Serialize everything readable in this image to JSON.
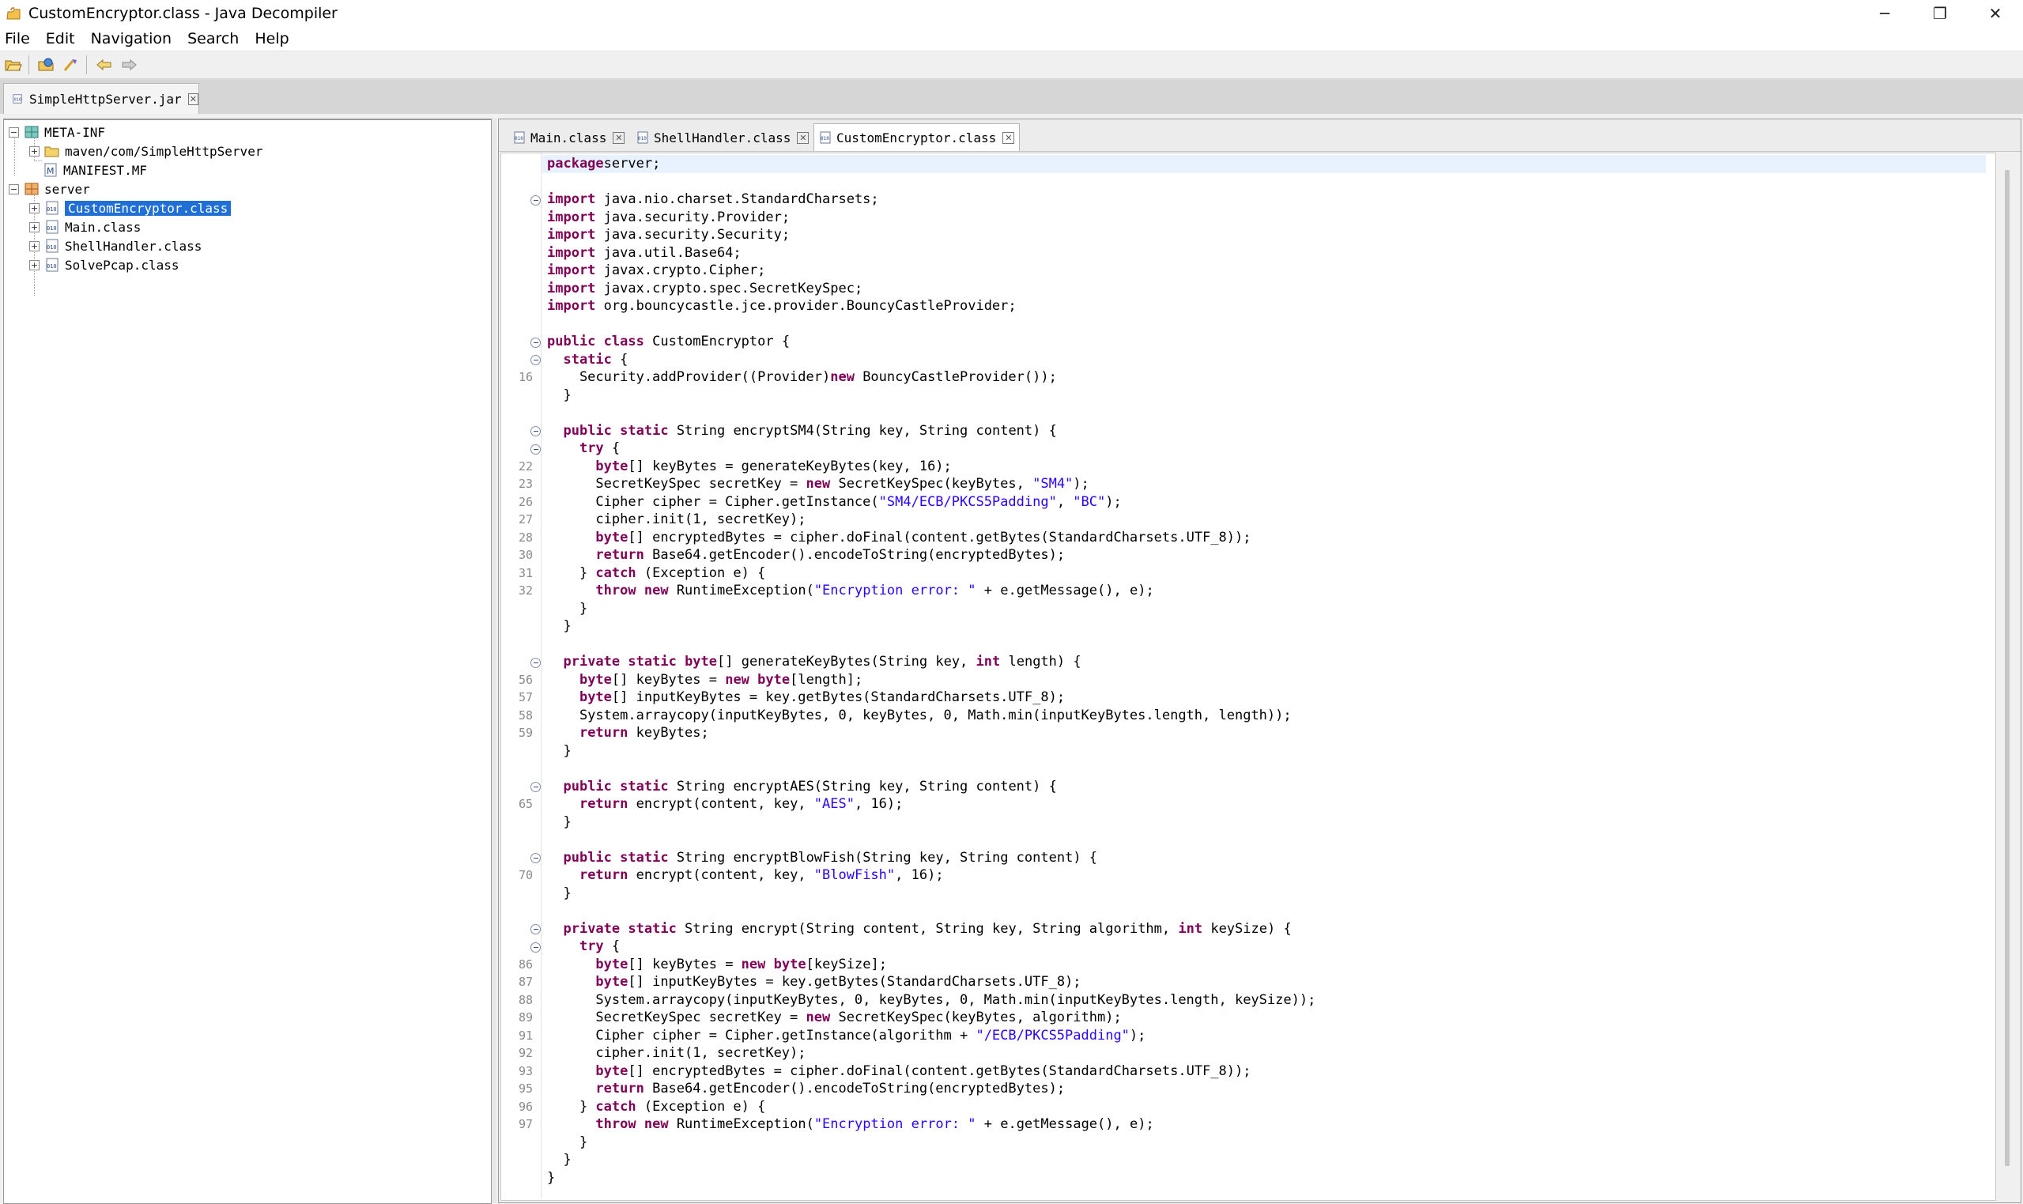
{
  "window": {
    "title": "CustomEncryptor.class - Java Decompiler",
    "controls": {
      "minimize": "─",
      "maximize": "❐",
      "close": "✕"
    }
  },
  "menu": [
    "File",
    "Edit",
    "Navigation",
    "Search",
    "Help"
  ],
  "toolbar": {
    "buttons": [
      "open-file-icon",
      "open-type-icon",
      "search-icon",
      "back-icon",
      "forward-icon"
    ]
  },
  "file_tabs": [
    {
      "label": "SimpleHttpServer.jar",
      "active": true
    }
  ],
  "tree": {
    "nodes": [
      {
        "label": "META-INF",
        "level": 0,
        "icon": "package-folder-icon",
        "expander": "−"
      },
      {
        "label": "maven/com/SimpleHttpServer",
        "level": 1,
        "icon": "folder-icon",
        "expander": "+"
      },
      {
        "label": "MANIFEST.MF",
        "level": 1,
        "icon": "manifest-icon",
        "expander": ""
      },
      {
        "label": "server",
        "level": 0,
        "icon": "package-icon",
        "expander": "−"
      },
      {
        "label": "CustomEncryptor.class",
        "level": 1,
        "icon": "class-file-icon",
        "expander": "+",
        "selected": true
      },
      {
        "label": "Main.class",
        "level": 1,
        "icon": "class-file-icon",
        "expander": "+"
      },
      {
        "label": "ShellHandler.class",
        "level": 1,
        "icon": "class-file-icon",
        "expander": "+"
      },
      {
        "label": "SolvePcap.class",
        "level": 1,
        "icon": "class-file-icon",
        "expander": "+"
      }
    ]
  },
  "editor_tabs": [
    {
      "label": "Main.class",
      "active": false
    },
    {
      "label": "ShellHandler.class",
      "active": false
    },
    {
      "label": "CustomEncryptor.class",
      "active": true
    }
  ],
  "code": {
    "lines": [
      {
        "ln": "",
        "fold": false,
        "parts": [
          [
            "kw",
            "package"
          ],
          [
            "",
            "server;"
          ]
        ]
      },
      {
        "ln": "",
        "fold": false,
        "parts": []
      },
      {
        "ln": "",
        "fold": true,
        "parts": [
          [
            "kw",
            "import"
          ],
          [
            "",
            " java.nio.charset.StandardCharsets;"
          ]
        ]
      },
      {
        "ln": "",
        "fold": false,
        "parts": [
          [
            "kw",
            "import"
          ],
          [
            "",
            " java.security.Provider;"
          ]
        ]
      },
      {
        "ln": "",
        "fold": false,
        "parts": [
          [
            "kw",
            "import"
          ],
          [
            "",
            " java.security.Security;"
          ]
        ]
      },
      {
        "ln": "",
        "fold": false,
        "parts": [
          [
            "kw",
            "import"
          ],
          [
            "",
            " java.util.Base64;"
          ]
        ]
      },
      {
        "ln": "",
        "fold": false,
        "parts": [
          [
            "kw",
            "import"
          ],
          [
            "",
            " javax.crypto.Cipher;"
          ]
        ]
      },
      {
        "ln": "",
        "fold": false,
        "parts": [
          [
            "kw",
            "import"
          ],
          [
            "",
            " javax.crypto.spec.SecretKeySpec;"
          ]
        ]
      },
      {
        "ln": "",
        "fold": false,
        "parts": [
          [
            "kw",
            "import"
          ],
          [
            "",
            " org.bouncycastle.jce.provider.BouncyCastleProvider;"
          ]
        ]
      },
      {
        "ln": "",
        "fold": false,
        "parts": []
      },
      {
        "ln": "",
        "fold": true,
        "parts": [
          [
            "kw",
            "public"
          ],
          [
            "",
            " "
          ],
          [
            "kw",
            "class"
          ],
          [
            "",
            " CustomEncryptor {"
          ]
        ]
      },
      {
        "ln": "",
        "fold": true,
        "parts": [
          [
            "",
            "  "
          ],
          [
            "kw",
            "static"
          ],
          [
            "",
            " {"
          ]
        ]
      },
      {
        "ln": "16",
        "fold": false,
        "parts": [
          [
            "",
            "    Security.addProvider((Provider)"
          ],
          [
            "kw",
            "new"
          ],
          [
            "",
            " BouncyCastleProvider());"
          ]
        ]
      },
      {
        "ln": "",
        "fold": false,
        "parts": [
          [
            "",
            "  }"
          ]
        ]
      },
      {
        "ln": "",
        "fold": false,
        "parts": []
      },
      {
        "ln": "",
        "fold": true,
        "parts": [
          [
            "",
            "  "
          ],
          [
            "kw",
            "public"
          ],
          [
            "",
            " "
          ],
          [
            "kw",
            "static"
          ],
          [
            "",
            " String encryptSM4(String key, String content) {"
          ]
        ]
      },
      {
        "ln": "",
        "fold": true,
        "parts": [
          [
            "",
            "    "
          ],
          [
            "kw",
            "try"
          ],
          [
            "",
            " {"
          ]
        ]
      },
      {
        "ln": "22",
        "fold": false,
        "parts": [
          [
            "",
            "      "
          ],
          [
            "kw",
            "byte"
          ],
          [
            "",
            "[] keyBytes = generateKeyBytes(key, 16);"
          ]
        ]
      },
      {
        "ln": "23",
        "fold": false,
        "parts": [
          [
            "",
            "      SecretKeySpec secretKey = "
          ],
          [
            "kw",
            "new"
          ],
          [
            "",
            " SecretKeySpec(keyBytes, "
          ],
          [
            "str",
            "\"SM4\""
          ],
          [
            "",
            ");"
          ]
        ]
      },
      {
        "ln": "26",
        "fold": false,
        "parts": [
          [
            "",
            "      Cipher cipher = Cipher.getInstance("
          ],
          [
            "str",
            "\"SM4/ECB/PKCS5Padding\""
          ],
          [
            "",
            ", "
          ],
          [
            "str",
            "\"BC\""
          ],
          [
            "",
            ");"
          ]
        ]
      },
      {
        "ln": "27",
        "fold": false,
        "parts": [
          [
            "",
            "      cipher.init(1, secretKey);"
          ]
        ]
      },
      {
        "ln": "28",
        "fold": false,
        "parts": [
          [
            "",
            "      "
          ],
          [
            "kw",
            "byte"
          ],
          [
            "",
            "[] encryptedBytes = cipher.doFinal(content.getBytes(StandardCharsets.UTF_8));"
          ]
        ]
      },
      {
        "ln": "30",
        "fold": false,
        "parts": [
          [
            "",
            "      "
          ],
          [
            "kw",
            "return"
          ],
          [
            "",
            " Base64.getEncoder().encodeToString(encryptedBytes);"
          ]
        ]
      },
      {
        "ln": "31",
        "fold": false,
        "parts": [
          [
            "",
            "    } "
          ],
          [
            "kw",
            "catch"
          ],
          [
            "",
            " (Exception e) {"
          ]
        ]
      },
      {
        "ln": "32",
        "fold": false,
        "parts": [
          [
            "",
            "      "
          ],
          [
            "kw",
            "throw"
          ],
          [
            "",
            " "
          ],
          [
            "kw",
            "new"
          ],
          [
            "",
            " RuntimeException("
          ],
          [
            "str",
            "\"Encryption error: \""
          ],
          [
            "",
            " + e.getMessage(), e);"
          ]
        ]
      },
      {
        "ln": "",
        "fold": false,
        "parts": [
          [
            "",
            "    }"
          ]
        ]
      },
      {
        "ln": "",
        "fold": false,
        "parts": [
          [
            "",
            "  }"
          ]
        ]
      },
      {
        "ln": "",
        "fold": false,
        "parts": []
      },
      {
        "ln": "",
        "fold": true,
        "parts": [
          [
            "",
            "  "
          ],
          [
            "kw",
            "private"
          ],
          [
            "",
            " "
          ],
          [
            "kw",
            "static"
          ],
          [
            "",
            " "
          ],
          [
            "kw",
            "byte"
          ],
          [
            "",
            "[] generateKeyBytes(String key, "
          ],
          [
            "kw",
            "int"
          ],
          [
            "",
            " length) {"
          ]
        ]
      },
      {
        "ln": "56",
        "fold": false,
        "parts": [
          [
            "",
            "    "
          ],
          [
            "kw",
            "byte"
          ],
          [
            "",
            "[] keyBytes = "
          ],
          [
            "kw",
            "new"
          ],
          [
            "",
            " "
          ],
          [
            "kw",
            "byte"
          ],
          [
            "",
            "[length];"
          ]
        ]
      },
      {
        "ln": "57",
        "fold": false,
        "parts": [
          [
            "",
            "    "
          ],
          [
            "kw",
            "byte"
          ],
          [
            "",
            "[] inputKeyBytes = key.getBytes(StandardCharsets.UTF_8);"
          ]
        ]
      },
      {
        "ln": "58",
        "fold": false,
        "parts": [
          [
            "",
            "    System.arraycopy(inputKeyBytes, 0, keyBytes, 0, Math.min(inputKeyBytes.length, length));"
          ]
        ]
      },
      {
        "ln": "59",
        "fold": false,
        "parts": [
          [
            "",
            "    "
          ],
          [
            "kw",
            "return"
          ],
          [
            "",
            " keyBytes;"
          ]
        ]
      },
      {
        "ln": "",
        "fold": false,
        "parts": [
          [
            "",
            "  }"
          ]
        ]
      },
      {
        "ln": "",
        "fold": false,
        "parts": []
      },
      {
        "ln": "",
        "fold": true,
        "parts": [
          [
            "",
            "  "
          ],
          [
            "kw",
            "public"
          ],
          [
            "",
            " "
          ],
          [
            "kw",
            "static"
          ],
          [
            "",
            " String encryptAES(String key, String content) {"
          ]
        ]
      },
      {
        "ln": "65",
        "fold": false,
        "parts": [
          [
            "",
            "    "
          ],
          [
            "kw",
            "return"
          ],
          [
            "",
            " encrypt(content, key, "
          ],
          [
            "str",
            "\"AES\""
          ],
          [
            "",
            ", 16);"
          ]
        ]
      },
      {
        "ln": "",
        "fold": false,
        "parts": [
          [
            "",
            "  }"
          ]
        ]
      },
      {
        "ln": "",
        "fold": false,
        "parts": []
      },
      {
        "ln": "",
        "fold": true,
        "parts": [
          [
            "",
            "  "
          ],
          [
            "kw",
            "public"
          ],
          [
            "",
            " "
          ],
          [
            "kw",
            "static"
          ],
          [
            "",
            " String encryptBlowFish(String key, String content) {"
          ]
        ]
      },
      {
        "ln": "70",
        "fold": false,
        "parts": [
          [
            "",
            "    "
          ],
          [
            "kw",
            "return"
          ],
          [
            "",
            " encrypt(content, key, "
          ],
          [
            "str",
            "\"BlowFish\""
          ],
          [
            "",
            ", 16);"
          ]
        ]
      },
      {
        "ln": "",
        "fold": false,
        "parts": [
          [
            "",
            "  }"
          ]
        ]
      },
      {
        "ln": "",
        "fold": false,
        "parts": []
      },
      {
        "ln": "",
        "fold": true,
        "parts": [
          [
            "",
            "  "
          ],
          [
            "kw",
            "private"
          ],
          [
            "",
            " "
          ],
          [
            "kw",
            "static"
          ],
          [
            "",
            " String encrypt(String content, String key, String algorithm, "
          ],
          [
            "kw",
            "int"
          ],
          [
            "",
            " keySize) {"
          ]
        ]
      },
      {
        "ln": "",
        "fold": true,
        "parts": [
          [
            "",
            "    "
          ],
          [
            "kw",
            "try"
          ],
          [
            "",
            " {"
          ]
        ]
      },
      {
        "ln": "86",
        "fold": false,
        "parts": [
          [
            "",
            "      "
          ],
          [
            "kw",
            "byte"
          ],
          [
            "",
            "[] keyBytes = "
          ],
          [
            "kw",
            "new"
          ],
          [
            "",
            " "
          ],
          [
            "kw",
            "byte"
          ],
          [
            "",
            "[keySize];"
          ]
        ]
      },
      {
        "ln": "87",
        "fold": false,
        "parts": [
          [
            "",
            "      "
          ],
          [
            "kw",
            "byte"
          ],
          [
            "",
            "[] inputKeyBytes = key.getBytes(StandardCharsets.UTF_8);"
          ]
        ]
      },
      {
        "ln": "88",
        "fold": false,
        "parts": [
          [
            "",
            "      System.arraycopy(inputKeyBytes, 0, keyBytes, 0, Math.min(inputKeyBytes.length, keySize));"
          ]
        ]
      },
      {
        "ln": "89",
        "fold": false,
        "parts": [
          [
            "",
            "      SecretKeySpec secretKey = "
          ],
          [
            "kw",
            "new"
          ],
          [
            "",
            " SecretKeySpec(keyBytes, algorithm);"
          ]
        ]
      },
      {
        "ln": "91",
        "fold": false,
        "parts": [
          [
            "",
            "      Cipher cipher = Cipher.getInstance(algorithm + "
          ],
          [
            "str",
            "\"/ECB/PKCS5Padding\""
          ],
          [
            "",
            ");"
          ]
        ]
      },
      {
        "ln": "92",
        "fold": false,
        "parts": [
          [
            "",
            "      cipher.init(1, secretKey);"
          ]
        ]
      },
      {
        "ln": "93",
        "fold": false,
        "parts": [
          [
            "",
            "      "
          ],
          [
            "kw",
            "byte"
          ],
          [
            "",
            "[] encryptedBytes = cipher.doFinal(content.getBytes(StandardCharsets.UTF_8));"
          ]
        ]
      },
      {
        "ln": "95",
        "fold": false,
        "parts": [
          [
            "",
            "      "
          ],
          [
            "kw",
            "return"
          ],
          [
            "",
            " Base64.getEncoder().encodeToString(encryptedBytes);"
          ]
        ]
      },
      {
        "ln": "96",
        "fold": false,
        "parts": [
          [
            "",
            "    } "
          ],
          [
            "kw",
            "catch"
          ],
          [
            "",
            " (Exception e) {"
          ]
        ]
      },
      {
        "ln": "97",
        "fold": false,
        "parts": [
          [
            "",
            "      "
          ],
          [
            "kw",
            "throw"
          ],
          [
            "",
            " "
          ],
          [
            "kw",
            "new"
          ],
          [
            "",
            " RuntimeException("
          ],
          [
            "str",
            "\"Encryption error: \""
          ],
          [
            "",
            " + e.getMessage(), e);"
          ]
        ]
      },
      {
        "ln": "",
        "fold": false,
        "parts": [
          [
            "",
            "    }"
          ]
        ]
      },
      {
        "ln": "",
        "fold": false,
        "parts": [
          [
            "",
            "  }"
          ]
        ]
      },
      {
        "ln": "",
        "fold": false,
        "parts": [
          [
            "",
            "}"
          ]
        ]
      }
    ]
  },
  "colors": {
    "keyword": "#7f0055",
    "string": "#2a00ff",
    "selection": "#1f6fd6",
    "line_number": "#8a8a8a"
  }
}
